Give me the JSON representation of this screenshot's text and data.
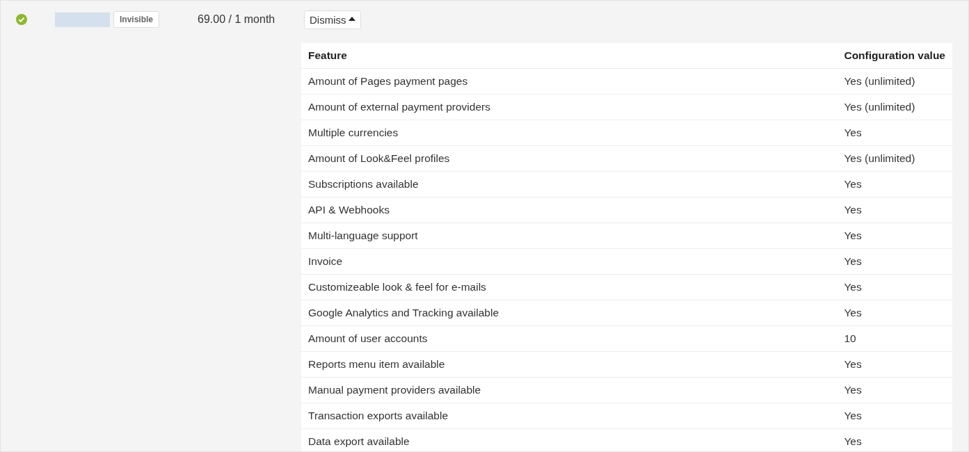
{
  "plan": {
    "badge": "Invisible",
    "price": "69.00 / 1 month",
    "dismiss_button": "Dismiss"
  },
  "table": {
    "columns": [
      "Feature",
      "Configuration value"
    ],
    "rows": [
      [
        "Amount of Pages payment pages",
        "Yes (unlimited)"
      ],
      [
        "Amount of external payment providers",
        "Yes (unlimited)"
      ],
      [
        "Multiple currencies",
        "Yes"
      ],
      [
        "Amount of Look&Feel profiles",
        "Yes (unlimited)"
      ],
      [
        "Subscriptions available",
        "Yes"
      ],
      [
        "API & Webhooks",
        "Yes"
      ],
      [
        "Multi-language support",
        "Yes"
      ],
      [
        "Invoice",
        "Yes"
      ],
      [
        "Customizeable look & feel for e-mails",
        "Yes"
      ],
      [
        "Google Analytics and Tracking available",
        "Yes"
      ],
      [
        "Amount of user accounts",
        "10"
      ],
      [
        "Reports menu item available",
        "Yes"
      ],
      [
        "Manual payment providers available",
        "Yes"
      ],
      [
        "Transaction exports available",
        "Yes"
      ],
      [
        "Data export available",
        "Yes"
      ]
    ]
  }
}
